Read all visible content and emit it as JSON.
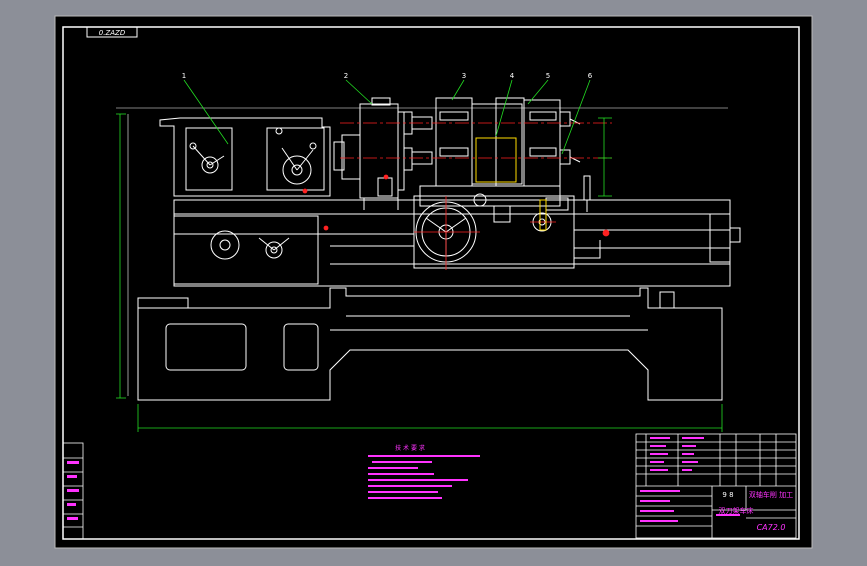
{
  "drawing": {
    "code_stamp": "0.ZAZD",
    "code_bottom": "CA72.0",
    "leader_numbers": [
      "1",
      "2",
      "3",
      "4",
      "5",
      "6"
    ],
    "notes_title": "技 术 要 求",
    "title_block": {
      "name_line1": "双轴车削 加工",
      "name_line2": "双刀架车床",
      "scale": "9 8"
    }
  },
  "colors": {
    "screen_bg": "#8c8f98",
    "paper": "#000000",
    "line": "#ffffff",
    "leader": "#22dd22",
    "center_line": "#ff2222",
    "dimension": "#22dd22",
    "annotation": "#ff33ff",
    "highlight": "#ffdd00"
  }
}
